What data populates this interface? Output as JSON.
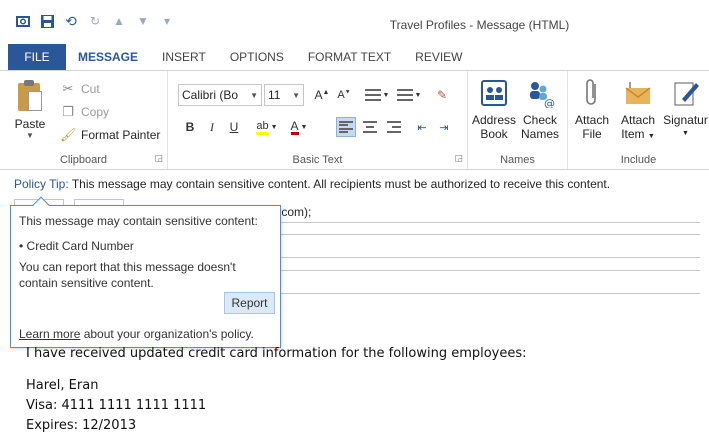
{
  "window": {
    "title": "Travel Profiles - Message (HTML)"
  },
  "tabs": [
    {
      "label": "FILE"
    },
    {
      "label": "MESSAGE"
    },
    {
      "label": "INSERT"
    },
    {
      "label": "OPTIONS"
    },
    {
      "label": "FORMAT TEXT"
    },
    {
      "label": "REVIEW"
    }
  ],
  "ribbon": {
    "clipboard": {
      "paste_label": "Paste",
      "cut_label": "Cut",
      "copy_label": "Copy",
      "format_painter_label": "Format Painter",
      "group_label": "Clipboard"
    },
    "basic_text": {
      "font_name": "Calibri (Bo",
      "font_size": "11",
      "bold": "B",
      "italic": "I",
      "underline": "U",
      "group_label": "Basic Text"
    },
    "names": {
      "address_book_line1": "Address",
      "address_book_line2": "Book",
      "check_names_line1": "Check",
      "check_names_line2": "Names",
      "group_label": "Names"
    },
    "include": {
      "attach_file_line1": "Attach",
      "attach_file_line2": "File",
      "attach_item_line1": "Attach",
      "attach_item_line2": "Item",
      "signature_label": "Signatur",
      "group_label": "Include"
    }
  },
  "policy_tip": {
    "title": "Policy Tip:",
    "text": "This message may contain sensitive content. All recipients must be authorized to receive this content."
  },
  "message": {
    "to_value_visible": ".com);"
  },
  "popup": {
    "header": "This message may contain sensitive content:",
    "item": "• Credit Card Number",
    "report_text": "You can report that this message doesn't contain sensitive content.",
    "report_button": "Report",
    "learn_more": "Learn more",
    "footer_text": " about your organization's policy."
  },
  "body": {
    "intro": "I have received updated credit card information for the following employees:",
    "name": "Harel, Eran",
    "visa": "Visa: 4111 1111 1111 1111",
    "expires": "Expires: 12/2013"
  },
  "colors": {
    "accent": "#2b579a",
    "popup_border": "#4f8ed7",
    "report_button_bg": "#dbe8f7"
  }
}
